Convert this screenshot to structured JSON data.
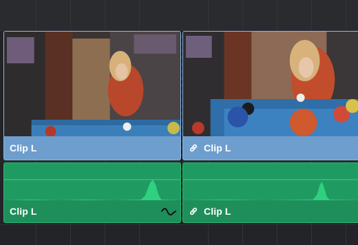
{
  "timeline": {
    "video_track": {
      "clips": [
        {
          "label": "Clip L",
          "linked": false
        },
        {
          "label": "Clip L",
          "linked": true
        }
      ]
    },
    "audio_track": {
      "clips": [
        {
          "label": "Clip L",
          "linked": false,
          "has_fade_handle": true
        },
        {
          "label": "Clip L",
          "linked": true,
          "has_fade_handle": false
        }
      ]
    }
  },
  "colors": {
    "video_clip": "#6e9ece",
    "audio_clip": "#1f9b62",
    "background": "#232427"
  }
}
